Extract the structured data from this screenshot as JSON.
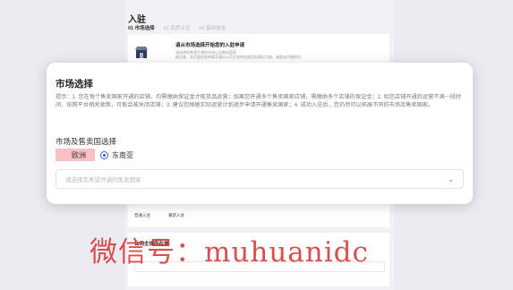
{
  "header": {
    "title": "入驻",
    "steps": [
      {
        "label": "01 市场选择",
        "active": true
      },
      {
        "label": "02 资质认证",
        "active": false
      },
      {
        "label": "03 基础信息",
        "active": false
      }
    ]
  },
  "intro_card": {
    "title": "请从市场选择开始您的入驻申请",
    "lines": [
      "请选择您希望开通的市场以及售卖国家",
      "请注意，本页面信息的填写请以公司主体所在地实际情况为准，请务必仔细核对"
    ]
  },
  "modal": {
    "title": "市场选择",
    "hint": "提示：1. 您在每个售卖国家开通的店铺，均需缴纳保证金才能货品运营；如果您开通多个售卖国家店铺，需缴纳多个店铺的保证金；2. 如您店铺开通后运营不满一段时间，依照平台相关政策，可能会被关闭店铺；3. 建议您根据实际运营计划逐步申请开通售卖国家；4. 成功入驻后，您仍然可以拓展不同的市场及售卖国家。",
    "section_label": "市场及售卖国选择",
    "regions": [
      {
        "label": "欧洲",
        "checked": false
      },
      {
        "label": "东南亚",
        "checked": true
      }
    ],
    "country_placeholder": "请选择您希望开通的售卖国家"
  },
  "store_type": {
    "options": [
      "普通入驻",
      "重新入驻"
    ]
  },
  "company_card": {
    "title": "公司主体所在地"
  },
  "watermark": "微信号：muhuanidc",
  "colors": {
    "accent": "#3b5bdb",
    "highlight": "#f7c1c5",
    "watermark": "#d22828"
  }
}
